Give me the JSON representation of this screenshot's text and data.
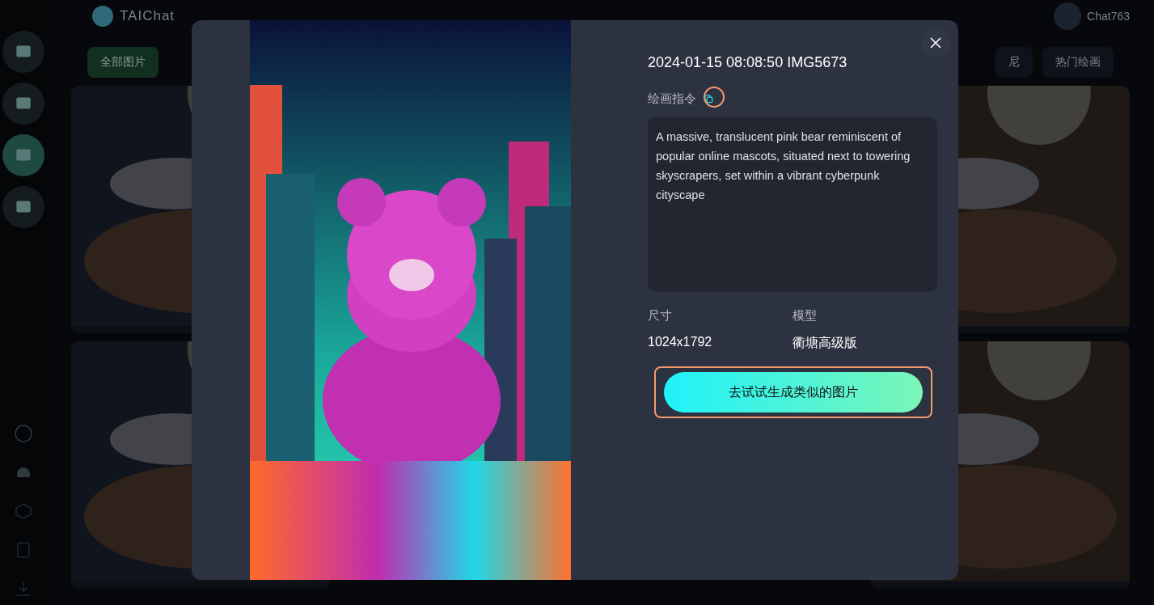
{
  "app": {
    "logo": "TAIChat",
    "user": "Chat763"
  },
  "sidebar": {
    "items": [
      {
        "selected": false
      },
      {
        "selected": false
      },
      {
        "selected": true
      },
      {
        "selected": false
      }
    ]
  },
  "tabs": [
    {
      "label": "全部图片",
      "selected": true
    },
    {
      "label": "尼",
      "selected": false
    },
    {
      "label": "热门绘画",
      "selected": false
    }
  ],
  "modal": {
    "title": "2024-01-15 08:08:50 IMG5673",
    "prompt_label": "绘画指令",
    "prompt": "A massive, translucent pink bear reminiscent of popular online mascots, situated next to towering skyscrapers, set within a vibrant cyberpunk cityscape",
    "size_label": "尺寸",
    "size": "1024x1792",
    "model_label": "模型",
    "model": "衢塘高级版",
    "button": "去试试生成类似的图片"
  }
}
